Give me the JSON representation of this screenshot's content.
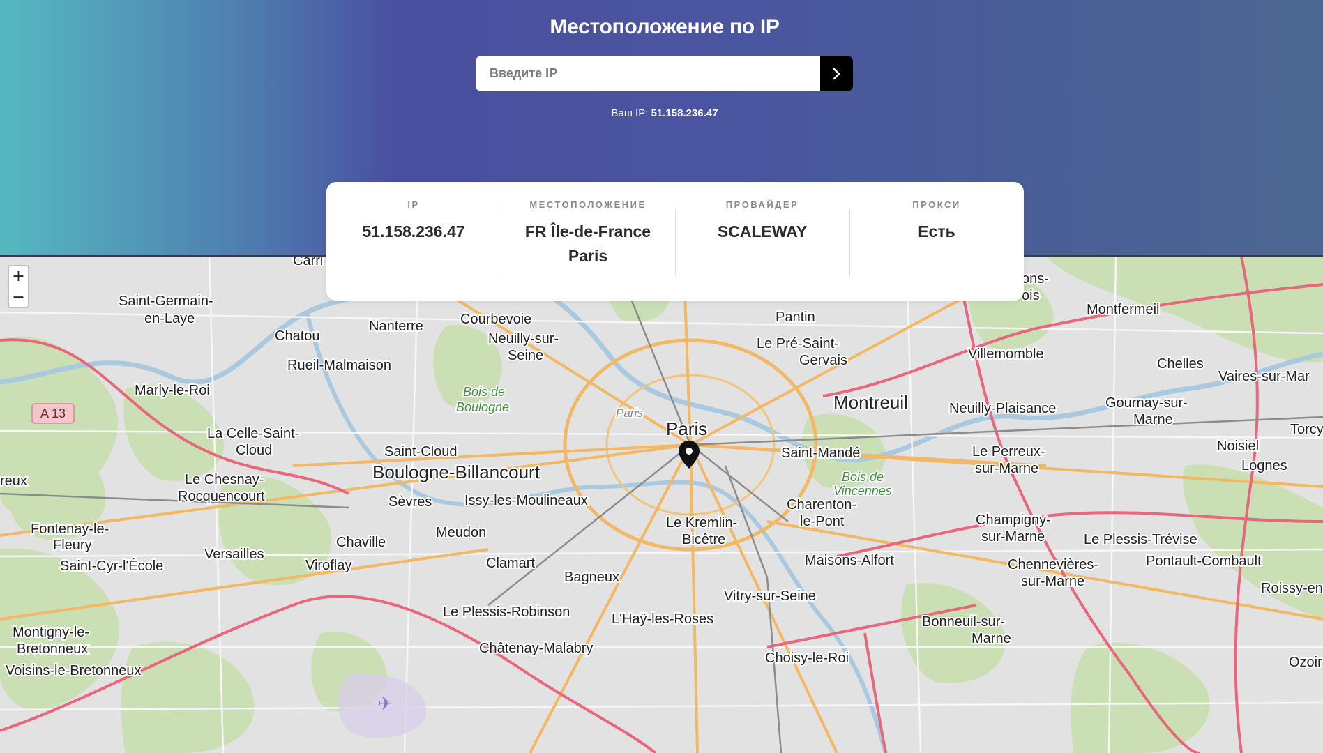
{
  "header": {
    "title": "Местоположение по IP",
    "search_placeholder": "Введите IP",
    "your_ip_label": "Ваш IP:",
    "your_ip_value": "51.158.236.47"
  },
  "info": [
    {
      "label": "IP",
      "value": "51.158.236.47"
    },
    {
      "label": "МЕСТОПОЛОЖЕНИЕ",
      "value": "FR Île-de-France Paris"
    },
    {
      "label": "ПРОВАЙДЕР",
      "value": "SCALEWAY"
    },
    {
      "label": "ПРОКСИ",
      "value": "Есть"
    }
  ],
  "map": {
    "zoom_in": "+",
    "zoom_out": "−",
    "places": [
      {
        "name": "Saint-Germain-"
      },
      {
        "name": "en-Laye"
      },
      {
        "name": "Chatou"
      },
      {
        "name": "Nanterre"
      },
      {
        "name": "Courbevoie"
      },
      {
        "name": "Neuilly-sur-"
      },
      {
        "name": "Seine"
      },
      {
        "name": "Rueil-Malmaison"
      },
      {
        "name": "Marly-le-Roi"
      },
      {
        "name": "Bois de"
      },
      {
        "name": "Boulogne"
      },
      {
        "name": "La Celle-Saint-"
      },
      {
        "name": "Cloud"
      },
      {
        "name": "Saint-Cloud"
      },
      {
        "name": "Boulogne-Billancourt"
      },
      {
        "name": "Le Chesnay-"
      },
      {
        "name": "Rocquencourt"
      },
      {
        "name": "Sèvres"
      },
      {
        "name": "Issy-les-Moulineaux"
      },
      {
        "name": "Meudon"
      },
      {
        "name": "Chaville"
      },
      {
        "name": "Fontenay-le-"
      },
      {
        "name": "Fleury"
      },
      {
        "name": "Versailles"
      },
      {
        "name": "Viroflay"
      },
      {
        "name": "Saint-Cyr-l'École"
      },
      {
        "name": "Clamart"
      },
      {
        "name": "Bagneux"
      },
      {
        "name": "Le Plessis-Robinson"
      },
      {
        "name": "Montigny-le-"
      },
      {
        "name": "Bretonneux"
      },
      {
        "name": "Voisins-le-Bretonneux"
      },
      {
        "name": "Châtenay-Malabry"
      },
      {
        "name": "L'Haÿ-les-Roses"
      },
      {
        "name": "Le Kremlin-"
      },
      {
        "name": "Bicêtre"
      },
      {
        "name": "Vitry-sur-Seine"
      },
      {
        "name": "Choisy-le-Roi"
      },
      {
        "name": "Pantin"
      },
      {
        "name": "Le Pré-Saint-"
      },
      {
        "name": "Gervais"
      },
      {
        "name": "Paris"
      },
      {
        "name": "Paris"
      },
      {
        "name": "Montreuil"
      },
      {
        "name": "Saint-Mandé"
      },
      {
        "name": "Bois de"
      },
      {
        "name": "Vincennes"
      },
      {
        "name": "Charenton-"
      },
      {
        "name": "le-Pont"
      },
      {
        "name": "Maisons-Alfort"
      },
      {
        "name": "Villemomble"
      },
      {
        "name": "Montfermeil"
      },
      {
        "name": "Chelles"
      },
      {
        "name": "Vaires-sur-Mar"
      },
      {
        "name": "Neuilly-Plaisance"
      },
      {
        "name": "Gournay-sur-"
      },
      {
        "name": "Marne"
      },
      {
        "name": "Torcy"
      },
      {
        "name": "Noisiel"
      },
      {
        "name": "Lognes"
      },
      {
        "name": "Le Perreux-"
      },
      {
        "name": "sur-Marne"
      },
      {
        "name": "Champigny-"
      },
      {
        "name": "sur-Marne"
      },
      {
        "name": "Le Plessis-Trévise"
      },
      {
        "name": "Chennevières-"
      },
      {
        "name": "sur-Marne"
      },
      {
        "name": "Pontault-Combault"
      },
      {
        "name": "Roissy-en"
      },
      {
        "name": "Bonneuil-sur-"
      },
      {
        "name": "Marne"
      },
      {
        "name": "Ozoir"
      },
      {
        "name": "reux"
      },
      {
        "name": "A 13"
      },
      {
        "name": "Carri"
      },
      {
        "name": "ons-"
      },
      {
        "name": "ois"
      }
    ]
  }
}
